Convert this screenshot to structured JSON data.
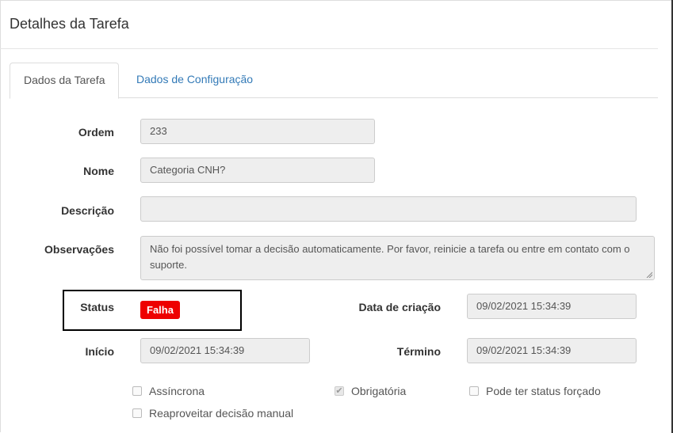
{
  "page_title": "Detalhes da Tarefa",
  "tabs": [
    {
      "label": "Dados da Tarefa",
      "active": true
    },
    {
      "label": "Dados de Configuração",
      "active": false
    }
  ],
  "form": {
    "ordem": {
      "label": "Ordem",
      "value": "233"
    },
    "nome": {
      "label": "Nome",
      "value": "Categoria CNH?"
    },
    "descricao": {
      "label": "Descrição",
      "value": ""
    },
    "observacoes": {
      "label": "Observações",
      "value": "Não foi possível tomar a decisão automaticamente. Por favor, reinicie a tarefa ou entre em contato com o suporte."
    },
    "status": {
      "label": "Status",
      "value": "Falha",
      "color": "#ee0000"
    },
    "data_criacao": {
      "label": "Data de criação",
      "value": "09/02/2021 15:34:39"
    },
    "inicio": {
      "label": "Início",
      "value": "09/02/2021 15:34:39"
    },
    "termino": {
      "label": "Término",
      "value": "09/02/2021 15:34:39"
    }
  },
  "checkboxes": {
    "assincrona": {
      "label": "Assíncrona",
      "checked": false
    },
    "obrigatoria": {
      "label": "Obrigatória",
      "checked": true
    },
    "status_forcado": {
      "label": "Pode ter status forçado",
      "checked": false
    },
    "reaproveitar": {
      "label": "Reaproveitar decisão manual",
      "checked": false
    }
  }
}
